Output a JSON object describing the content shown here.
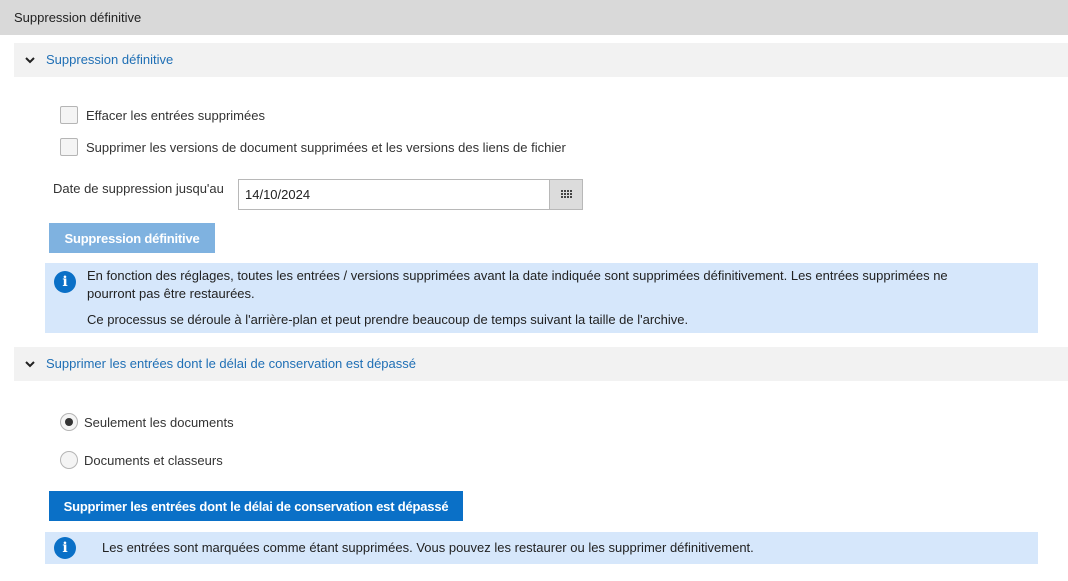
{
  "page_title": "Suppression définitive",
  "section1": {
    "header": "Suppression définitive",
    "checkboxes": [
      {
        "label": "Effacer les entrées supprimées",
        "checked": false
      },
      {
        "label": "Supprimer les versions de document supprimées et les versions des liens de fichier",
        "checked": false
      }
    ],
    "date_label": "Date de suppression jusqu'au",
    "date_value": "14/10/2024",
    "button_label": "Suppression définitive",
    "info_line1": "En fonction des réglages, toutes les entrées / versions supprimées avant la date indiquée sont supprimées définitivement. Les entrées supprimées ne",
    "info_line2": "pourront pas être restaurées.",
    "info_line3": "Ce processus se déroule à l'arrière-plan et peut prendre beaucoup de temps suivant la taille de l'archive."
  },
  "section2": {
    "header": "Supprimer les entrées dont le délai de conservation est dépassé",
    "radios": [
      {
        "label": "Seulement les documents",
        "checked": true
      },
      {
        "label": "Documents et classeurs",
        "checked": false
      }
    ],
    "button_label": "Supprimer les entrées dont le délai de conservation est dépassé",
    "info_text": "Les entrées sont marquées comme étant supprimées. Vous pouvez les restaurer ou les supprimer définitivement."
  },
  "icons": {
    "chevron": "chevron-down-icon",
    "calendar": "calendar-icon",
    "info": "info-icon"
  },
  "colors": {
    "link": "#1f6fb5",
    "primary_button": "#0a70c7",
    "disabled_button": "#7fb2e0",
    "info_background": "#d6e7fb"
  }
}
